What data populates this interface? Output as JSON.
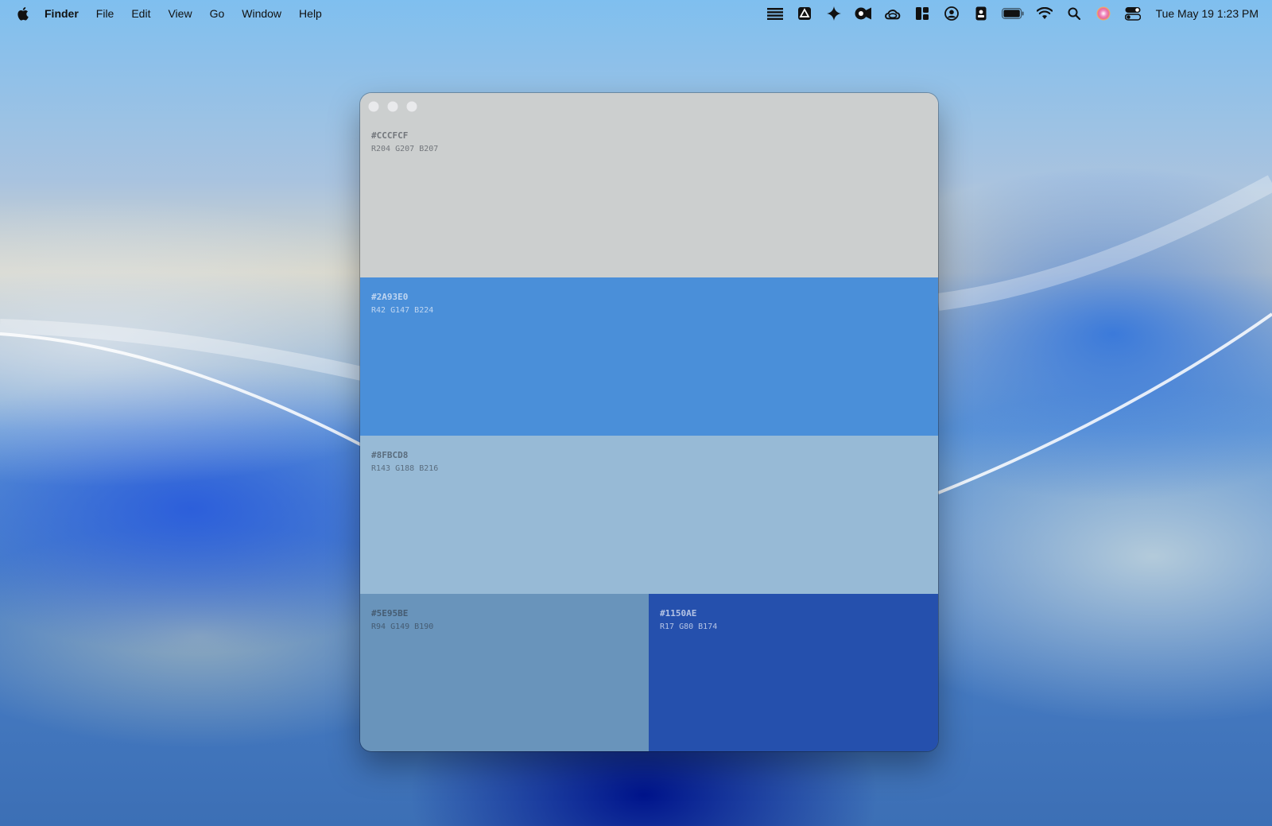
{
  "menubar": {
    "app_name": "Finder",
    "menus": [
      "File",
      "Edit",
      "View",
      "Go",
      "Window",
      "Help"
    ],
    "status_icons": [
      "hamburger-list-icon",
      "drive-icon",
      "sparkle-icon",
      "video-camera-icon",
      "creative-cloud-icon",
      "grid-layout-icon",
      "user-circle-icon",
      "id-badge-icon",
      "battery-icon",
      "wifi-icon",
      "search-icon",
      "siri-icon",
      "control-center-icon"
    ],
    "clock": "Tue May 19  1:23 PM"
  },
  "window": {
    "swatches": [
      {
        "hex": "#CCCFCF",
        "rgb": "R204 G207 B207",
        "color": "#CCCFCF"
      },
      {
        "hex": "#2A93E0",
        "rgb": "R42 G147 B224",
        "color": "#4A8FD9"
      },
      {
        "hex": "#8FBCD8",
        "rgb": "R143 G188 B216",
        "color": "#97BAD6"
      },
      {
        "hex": "#5E95BE",
        "rgb": "R94 G149 B190",
        "color": "#6994BB"
      },
      {
        "hex": "#1150AE",
        "rgb": "R17 G80 B174",
        "color": "#2550AD"
      }
    ]
  }
}
